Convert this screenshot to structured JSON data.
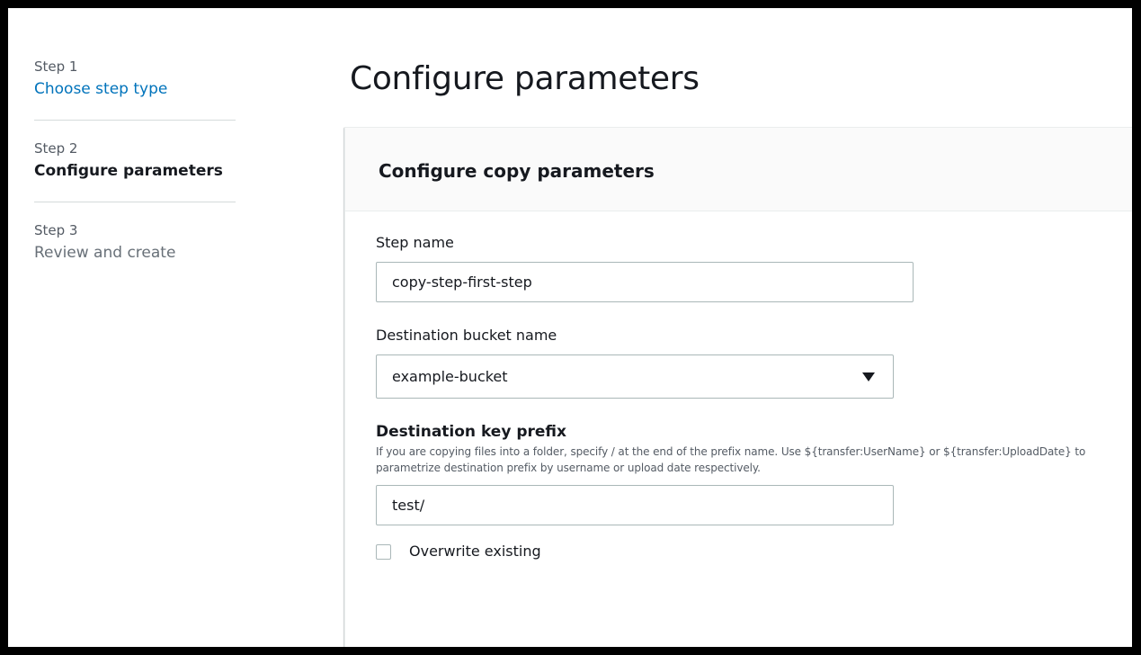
{
  "wizard": {
    "steps": [
      {
        "number": "Step 1",
        "title": "Choose step type",
        "state": "link"
      },
      {
        "number": "Step 2",
        "title": "Configure parameters",
        "state": "current"
      },
      {
        "number": "Step 3",
        "title": "Review and create",
        "state": "disabled"
      }
    ]
  },
  "page": {
    "title": "Configure parameters"
  },
  "container": {
    "title": "Configure copy parameters"
  },
  "form": {
    "step_name": {
      "label": "Step name",
      "value": "copy-step-first-step"
    },
    "destination_bucket": {
      "label": "Destination bucket name",
      "value": "example-bucket",
      "icon": "caret-down-icon"
    },
    "destination_prefix": {
      "label": "Destination key prefix",
      "description": "If you are copying files into a folder, specify / at the end of the prefix name. Use ${transfer:UserName} or ${transfer:UploadDate} to parametrize destination prefix by username or upload date respectively.",
      "value": "test/"
    },
    "overwrite": {
      "label": "Overwrite existing",
      "checked": false
    }
  },
  "colors": {
    "link": "#0073bb",
    "text": "#16191f",
    "muted": "#687078",
    "border": "#aab7b8"
  }
}
